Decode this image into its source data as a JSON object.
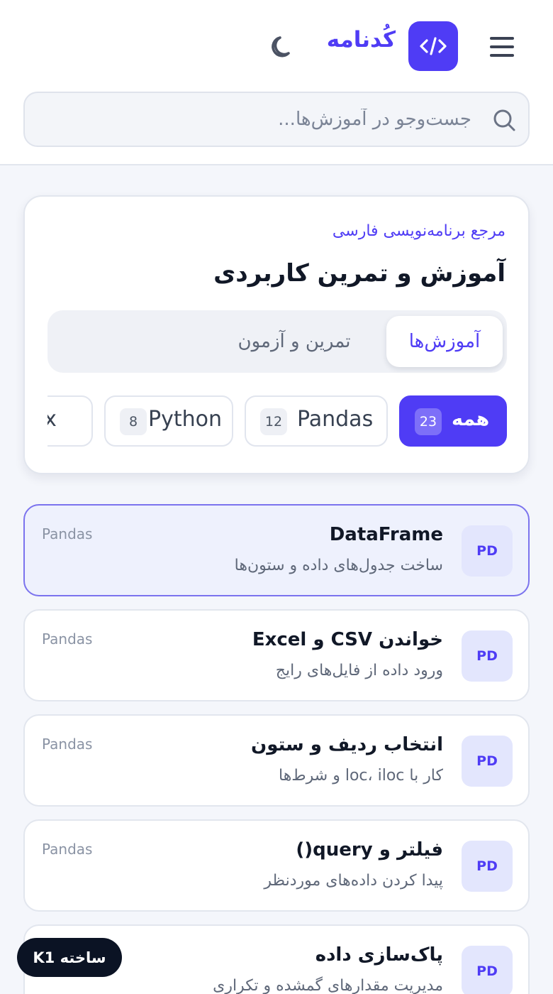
{
  "header": {
    "brand_name": "کُدنامه",
    "logo_glyph": "</>",
    "brand_color": "#4f3cf5",
    "menu_icon": "hamburger-menu-icon",
    "theme_icon": "moon-icon"
  },
  "search": {
    "placeholder": "جست‌وجو در آموزش‌ها...",
    "value": "",
    "icon": "search-icon"
  },
  "hero": {
    "kicker": "مرجع برنامه‌نویسی فارسی",
    "title": "آموزش و تمرین کاربردی",
    "tabs": [
      {
        "label": "آموزش‌ها",
        "active": true
      },
      {
        "label": "تمرین و آزمون",
        "active": false
      }
    ],
    "chips": [
      {
        "label": "همه",
        "count": "23",
        "active": true
      },
      {
        "label": "Pandas",
        "count": "12",
        "active": false
      },
      {
        "label": "Python",
        "count": "8",
        "active": false
      },
      {
        "label": "Linux",
        "count": "",
        "active": false
      }
    ]
  },
  "lessons": [
    {
      "badge": "PD",
      "title": "DataFrame",
      "description": "ساخت جدول‌های داده و ستون‌ها",
      "tag": "Pandas",
      "selected": true
    },
    {
      "badge": "PD",
      "title": "خواندن CSV و Excel",
      "description": "ورود داده از فایل‌های رایج",
      "tag": "Pandas",
      "selected": false
    },
    {
      "badge": "PD",
      "title": "انتخاب ردیف و ستون",
      "description": "کار با loc، iloc و شرط‌ها",
      "tag": "Pandas",
      "selected": false
    },
    {
      "badge": "PD",
      "title": "فیلتر و query()",
      "description": "پیدا کردن داده‌های موردنظر",
      "tag": "Pandas",
      "selected": false
    },
    {
      "badge": "PD",
      "title": "پاک‌سازی داده",
      "description": "مدیریت مقدارهای گمشده و تکراری",
      "tag": "",
      "selected": false
    }
  ],
  "build_badge": "ساخته K1"
}
